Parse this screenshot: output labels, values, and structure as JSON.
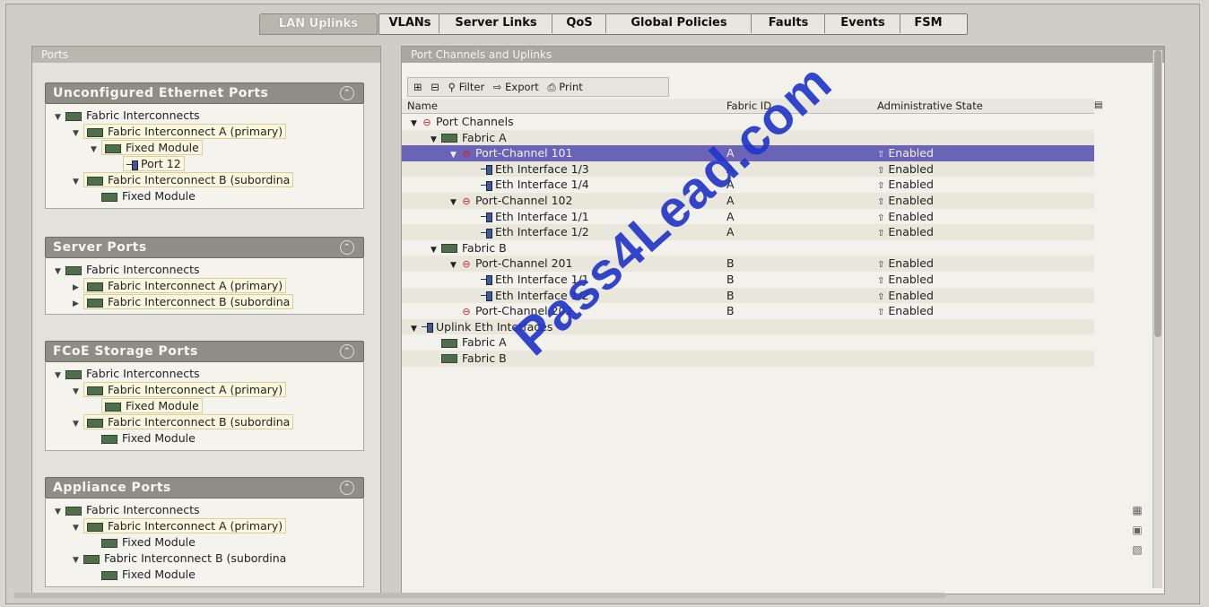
{
  "tabs": [
    {
      "label": "LAN Uplinks",
      "active": true
    },
    {
      "label": "VLANs"
    },
    {
      "label": "Server Links"
    },
    {
      "label": "QoS"
    },
    {
      "label": "Global Policies"
    },
    {
      "label": "Faults"
    },
    {
      "label": "Events"
    },
    {
      "label": "FSM"
    }
  ],
  "left_pane": {
    "title": "Ports",
    "sections": [
      {
        "title": "Unconfigured Ethernet Ports",
        "items": [
          {
            "label": "Fabric Interconnects",
            "indent": 0,
            "toggle": "▼",
            "icon": "fi"
          },
          {
            "label": "Fabric Interconnect A (primary)",
            "indent": 1,
            "toggle": "▼",
            "icon": "fi",
            "hl": true
          },
          {
            "label": "Fixed Module",
            "indent": 2,
            "toggle": "▼",
            "icon": "fi",
            "hl": true
          },
          {
            "label": "Port 12",
            "indent": 3,
            "toggle": "",
            "icon": "port",
            "hl": true
          },
          {
            "label": "Fabric Interconnect B (subordina",
            "indent": 1,
            "toggle": "▼",
            "icon": "fi",
            "hl": true
          },
          {
            "label": "Fixed Module",
            "indent": 2,
            "toggle": "",
            "icon": "fi"
          }
        ]
      },
      {
        "title": "Server Ports",
        "items": [
          {
            "label": "Fabric Interconnects",
            "indent": 0,
            "toggle": "▼",
            "icon": "fi"
          },
          {
            "label": "Fabric Interconnect A (primary)",
            "indent": 1,
            "toggle": "▶",
            "icon": "fi",
            "hl": true
          },
          {
            "label": "Fabric Interconnect B (subordina",
            "indent": 1,
            "toggle": "▶",
            "icon": "fi",
            "hl": true
          }
        ]
      },
      {
        "title": "FCoE Storage Ports",
        "items": [
          {
            "label": "Fabric Interconnects",
            "indent": 0,
            "toggle": "▼",
            "icon": "fi"
          },
          {
            "label": "Fabric Interconnect A (primary)",
            "indent": 1,
            "toggle": "▼",
            "icon": "fi",
            "hl": true
          },
          {
            "label": "Fixed Module",
            "indent": 2,
            "toggle": "",
            "icon": "fi",
            "hl": true
          },
          {
            "label": "Fabric Interconnect B (subordina",
            "indent": 1,
            "toggle": "▼",
            "icon": "fi",
            "hl": true
          },
          {
            "label": "Fixed Module",
            "indent": 2,
            "toggle": "",
            "icon": "fi"
          }
        ]
      },
      {
        "title": "Appliance Ports",
        "items": [
          {
            "label": "Fabric Interconnects",
            "indent": 0,
            "toggle": "▼",
            "icon": "fi"
          },
          {
            "label": "Fabric Interconnect A (primary)",
            "indent": 1,
            "toggle": "▼",
            "icon": "fi",
            "hl": true
          },
          {
            "label": "Fixed Module",
            "indent": 2,
            "toggle": "",
            "icon": "fi"
          },
          {
            "label": "Fabric Interconnect B (subordina",
            "indent": 1,
            "toggle": "▼",
            "icon": "fi"
          },
          {
            "label": "Fixed Module",
            "indent": 2,
            "toggle": "",
            "icon": "fi"
          }
        ]
      }
    ]
  },
  "right_pane": {
    "title": "Port Channels and Uplinks",
    "toolbar": {
      "filter": "Filter",
      "export": "Export",
      "print": "Print"
    },
    "columns": [
      "Name",
      "Fabric ID",
      "Administrative State"
    ],
    "rows": [
      {
        "name": "Port Channels",
        "indent": 0,
        "toggle": "▼",
        "icon": "pc",
        "fabric": "",
        "state": ""
      },
      {
        "name": "Fabric A",
        "indent": 1,
        "toggle": "▼",
        "icon": "fi",
        "fabric": "",
        "state": ""
      },
      {
        "name": "Port-Channel 101",
        "indent": 2,
        "toggle": "▼",
        "icon": "pc",
        "fabric": "A",
        "state": "Enabled",
        "selected": true
      },
      {
        "name": "Eth Interface 1/3",
        "indent": 3,
        "toggle": "",
        "icon": "port",
        "fabric": "A",
        "state": "Enabled"
      },
      {
        "name": "Eth Interface 1/4",
        "indent": 3,
        "toggle": "",
        "icon": "port",
        "fabric": "A",
        "state": "Enabled"
      },
      {
        "name": "Port-Channel 102",
        "indent": 2,
        "toggle": "▼",
        "icon": "pc",
        "fabric": "A",
        "state": "Enabled"
      },
      {
        "name": "Eth Interface 1/1",
        "indent": 3,
        "toggle": "",
        "icon": "port",
        "fabric": "A",
        "state": "Enabled"
      },
      {
        "name": "Eth Interface 1/2",
        "indent": 3,
        "toggle": "",
        "icon": "port",
        "fabric": "A",
        "state": "Enabled"
      },
      {
        "name": "Fabric B",
        "indent": 1,
        "toggle": "▼",
        "icon": "fi",
        "fabric": "",
        "state": ""
      },
      {
        "name": "Port-Channel 201",
        "indent": 2,
        "toggle": "▼",
        "icon": "pc",
        "fabric": "B",
        "state": "Enabled"
      },
      {
        "name": "Eth Interface 1/1",
        "indent": 3,
        "toggle": "",
        "icon": "port",
        "fabric": "B",
        "state": "Enabled"
      },
      {
        "name": "Eth Interface 1/2",
        "indent": 3,
        "toggle": "",
        "icon": "port",
        "fabric": "B",
        "state": "Enabled"
      },
      {
        "name": "Port-Channel 202",
        "indent": 2,
        "toggle": "",
        "icon": "pc",
        "fabric": "B",
        "state": "Enabled"
      },
      {
        "name": "Uplink Eth Interfaces",
        "indent": 0,
        "toggle": "▼",
        "icon": "port",
        "fabric": "",
        "state": ""
      },
      {
        "name": "Fabric A",
        "indent": 1,
        "toggle": "",
        "icon": "fi",
        "fabric": "",
        "state": ""
      },
      {
        "name": "Fabric B",
        "indent": 1,
        "toggle": "",
        "icon": "fi",
        "fabric": "",
        "state": ""
      }
    ]
  },
  "watermark": "Pass4Lead.com"
}
